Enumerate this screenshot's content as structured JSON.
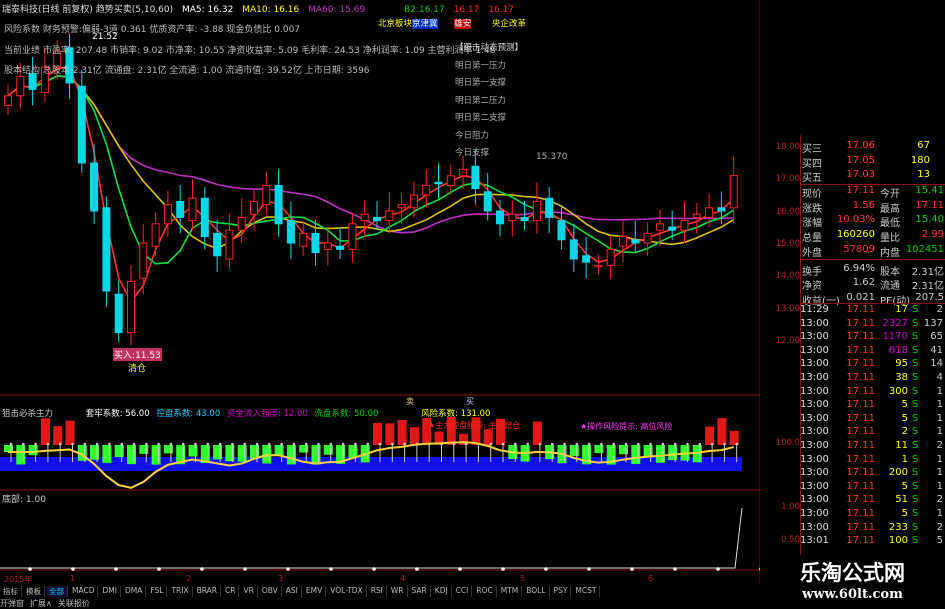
{
  "header": {
    "title": "瑞泰科技(日线 前复权) 趋势买卖(5,10,60)",
    "ma5": "MA5: 16.32",
    "ma10": "MA10: 16.16",
    "ma60": "MA60: 15.69",
    "b2": "B2:16.17",
    "r1": "16.17",
    "r2": "16.17"
  },
  "info": {
    "line1": "风险系数 财务预警:偏弱-3道 0.361 优质资产率: -3.88 现金负债比 0.007",
    "line2": "当前业绩 市盈率: 207.48 市销率: 9.02 市净率: 10.55 净资收益率: 5.09 毛利率: 24.53 净利润率: 1.09 主营利润率 1.48",
    "line3": "股本结构 总股本 2.31亿 流通盘: 2.31亿 全流通: 1.00 流通市值: 39.52亿 上市日期: 3596"
  },
  "tags": {
    "beijing": "北京板块",
    "blue": "京津冀",
    "red": "雄安",
    "policy": "央企改革"
  },
  "menu": [
    "【跟击动态预测】",
    "明日第一压力",
    "明日第一支撑",
    "明日第二压力",
    "明日第二支撑",
    "今日阻力",
    "今日支撑"
  ],
  "marks": {
    "high": "21.52",
    "low": "11.53",
    "low_tag": "清仓",
    "buy_tag": "买入",
    "mid_price": "15.370"
  },
  "price_axis": [
    "18.00",
    "17.00",
    "16.00",
    "15.00",
    "14.00",
    "13.00",
    "12.00"
  ],
  "candles": {
    "close": [
      19.6,
      20.2,
      19.8,
      20.5,
      21.0,
      20.0,
      17.5,
      16.0,
      13.5,
      12.2,
      13.8,
      15.0,
      15.6,
      16.2,
      15.8,
      16.4,
      15.2,
      14.6,
      15.4,
      15.8,
      16.3,
      16.8,
      15.6,
      15.0,
      15.3,
      14.7,
      15.0,
      14.8,
      15.6,
      15.9,
      15.7,
      16.0,
      16.2,
      16.5,
      16.8,
      16.9,
      17.1,
      17.3,
      16.7,
      16.0,
      15.6,
      15.9,
      15.7,
      16.3,
      15.8,
      15.1,
      14.5,
      14.4,
      14.3,
      14.8,
      15.2,
      15.0,
      15.3,
      15.6,
      15.4,
      15.7,
      15.9,
      16.1,
      16.0,
      17.11
    ]
  },
  "sub": {
    "title": "狙击必杀主力",
    "c1": "套牢系数: 56.00",
    "c2": "控盘系数: 43.00",
    "c3": "资金流入强度: 12.00",
    "c4": "洗盘系数: 50.00",
    "c5": "风险系数: 131.00",
    "note1": "★主力控盘阶段: 主力增仓",
    "note2": "★操作风险提示: 高位风险",
    "axis": "100.0",
    "sell_tag": "卖",
    "buy_tag": "买"
  },
  "bottom": {
    "title": "底部: 1.00",
    "axis1": "1.00",
    "axis2": "0.50"
  },
  "timeline": [
    "2015年",
    "1",
    "2",
    "3",
    "4",
    "5",
    "6"
  ],
  "tabs": [
    "指标",
    "模板",
    "全部",
    "MACD",
    "DMI",
    "DMA",
    "FSL",
    "TRIX",
    "BRAR",
    "CR",
    "VR",
    "OBV",
    "ASI",
    "EMV",
    "VOL-TDX",
    "RSI",
    "WR",
    "SAR",
    "KDJ",
    "CCI",
    "ROC",
    "MTM",
    "BOLL",
    "PSY",
    "MCST"
  ],
  "tabs2": [
    "开弹窗",
    "扩展∧",
    "关联报价"
  ],
  "quote": {
    "asks": [
      [
        "买三",
        "17.06",
        "67"
      ],
      [
        "买四",
        "17.05",
        "180"
      ],
      [
        "买五",
        "17.03",
        "13"
      ]
    ],
    "stats": [
      [
        "现价",
        "17.11",
        "今开",
        "15.41"
      ],
      [
        "涨跌",
        "1.56",
        "最高",
        "17.11"
      ],
      [
        "涨幅",
        "10.03%",
        "最低",
        "15.40"
      ],
      [
        "总量",
        "160260",
        "量比",
        "2.99"
      ],
      [
        "外盘",
        "57809",
        "内盘",
        "102451"
      ],
      [
        "换手",
        "6.94%",
        "股本",
        "2.31亿"
      ],
      [
        "净资",
        "1.62",
        "流通",
        "2.31亿"
      ],
      [
        "收益(一)",
        "0.021",
        "PE(动)",
        "207.5"
      ]
    ],
    "ticks": [
      [
        "11:29",
        "17.11",
        "17",
        "S",
        "2"
      ],
      [
        "13:00",
        "17.11",
        "2327",
        "S",
        "137"
      ],
      [
        "13:00",
        "17.11",
        "1170",
        "S",
        "65"
      ],
      [
        "13:00",
        "17.11",
        "618",
        "S",
        "41"
      ],
      [
        "13:00",
        "17.11",
        "95",
        "S",
        "14"
      ],
      [
        "13:00",
        "17.11",
        "38",
        "S",
        "4"
      ],
      [
        "13:00",
        "17.11",
        "300",
        "S",
        "1"
      ],
      [
        "13:00",
        "17.11",
        "5",
        "S",
        "1"
      ],
      [
        "13:00",
        "17.11",
        "5",
        "S",
        "1"
      ],
      [
        "13:00",
        "17.11",
        "2",
        "S",
        "1"
      ],
      [
        "13:00",
        "17.11",
        "11",
        "S",
        "2"
      ],
      [
        "13:00",
        "17.11",
        "1",
        "S",
        "1"
      ],
      [
        "13:00",
        "17.11",
        "200",
        "S",
        "1"
      ],
      [
        "13:00",
        "17.11",
        "5",
        "S",
        "1"
      ],
      [
        "13:00",
        "17.11",
        "51",
        "S",
        "2"
      ],
      [
        "13:00",
        "17.11",
        "5",
        "S",
        "1"
      ],
      [
        "13:00",
        "17.11",
        "233",
        "S",
        "2"
      ],
      [
        "13:01",
        "17.11",
        "100",
        "S",
        "5"
      ]
    ]
  },
  "watermark": {
    "name": "乐淘公式网",
    "url": "www.60lt.com"
  },
  "colors": {
    "up": "#ff2020",
    "down": "#00d8e8",
    "ma5": "#ffffff",
    "ma10": "#ffff00",
    "ma60": "#c030c0",
    "grid": "#8b1010"
  }
}
